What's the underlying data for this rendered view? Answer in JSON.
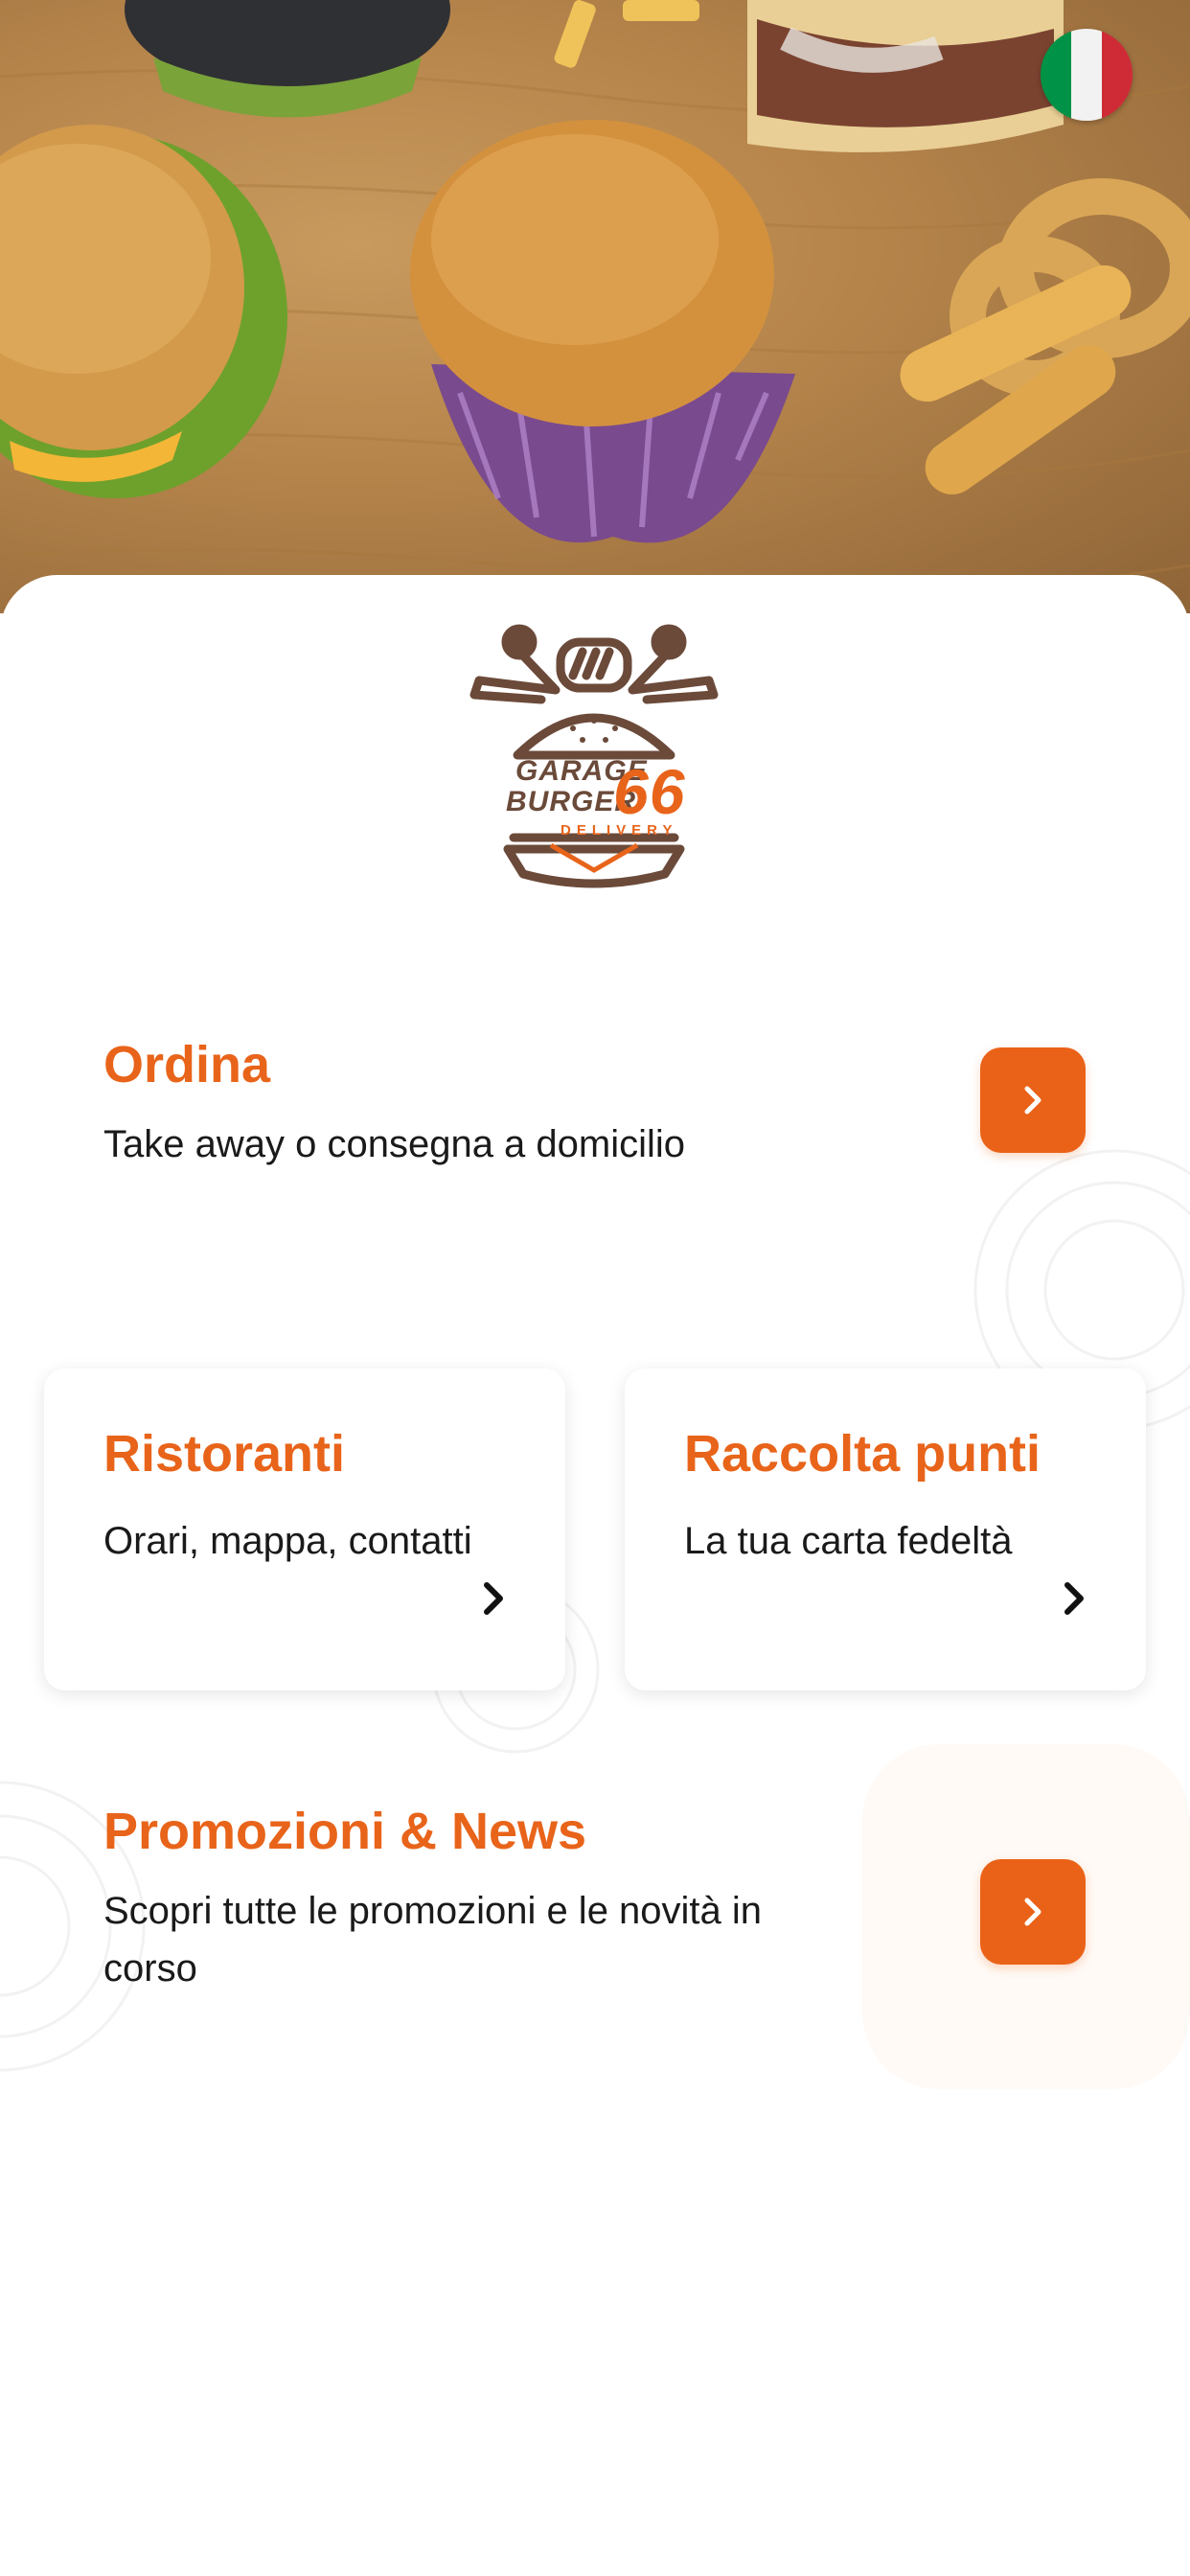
{
  "language": {
    "flag_colors": [
      "#009246",
      "#f1f2f1",
      "#ce2b37"
    ],
    "icon": "italy-flag-icon"
  },
  "brand": {
    "line1": "GARAGE",
    "line2": "BURGER",
    "number": "66",
    "tagline": "DELIVERY",
    "brown": "#6b4a3a",
    "orange": "#e8641a"
  },
  "order": {
    "title": "Ordina",
    "subtitle": "Take away o consegna a domicilio",
    "icon": "chevron-right-icon"
  },
  "restaurants": {
    "title": "Ristoranti",
    "subtitle": "Orari, mappa, contatti",
    "icon": "chevron-right-icon"
  },
  "loyalty": {
    "title": "Raccolta punti",
    "subtitle": "La tua carta fedeltà",
    "icon": "chevron-right-icon"
  },
  "promo": {
    "title": "Promozioni & News",
    "subtitle_line1": "Scopri tutte le promozioni e le novità in",
    "subtitle_line2": "corso",
    "icon": "chevron-right-icon"
  },
  "colors": {
    "accent": "#ea6218",
    "text": "#1a1a1a"
  }
}
